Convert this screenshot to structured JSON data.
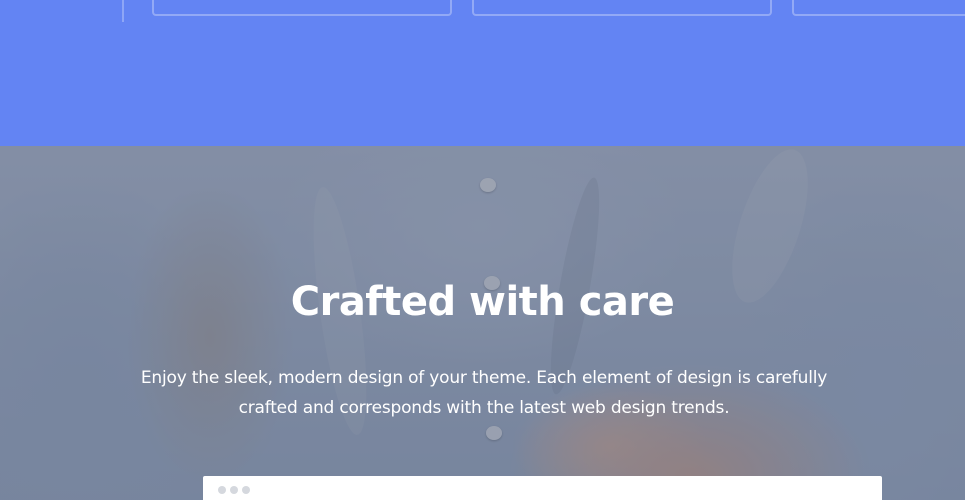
{
  "hero": {
    "title": "Crafted with care",
    "description": "Enjoy the sleek, modern design of your theme. Each element of design is carefully crafted and corresponds with the latest web design trends."
  },
  "colors": {
    "top_band": "#6384f3",
    "hero_text": "#ffffff",
    "browser_frame": "#ffffff"
  }
}
